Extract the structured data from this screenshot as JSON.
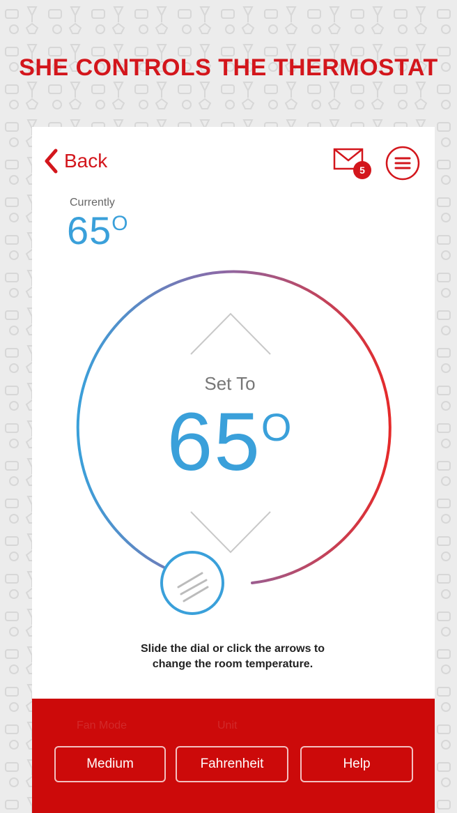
{
  "banner": {
    "title": "SHE CONTROLS THE THERMOSTAT"
  },
  "nav": {
    "back_label": "Back",
    "mail_badge": "5"
  },
  "current": {
    "label": "Currently",
    "temp": "65",
    "degree_symbol": "O"
  },
  "dial": {
    "set_label": "Set To",
    "set_temp": "65",
    "degree_symbol": "O",
    "hint_line1": "Slide the dial or click the arrows to",
    "hint_line2": "change the room temperature."
  },
  "footer": {
    "ghost_left": "Fan Mode",
    "ghost_right": "Unit",
    "buttons": [
      {
        "label": "Medium"
      },
      {
        "label": "Fahrenheit"
      },
      {
        "label": "Help"
      }
    ]
  },
  "colors": {
    "brand_red": "#d3161c",
    "cool_blue": "#3aa0da",
    "footer_red": "#cc0a0a"
  }
}
